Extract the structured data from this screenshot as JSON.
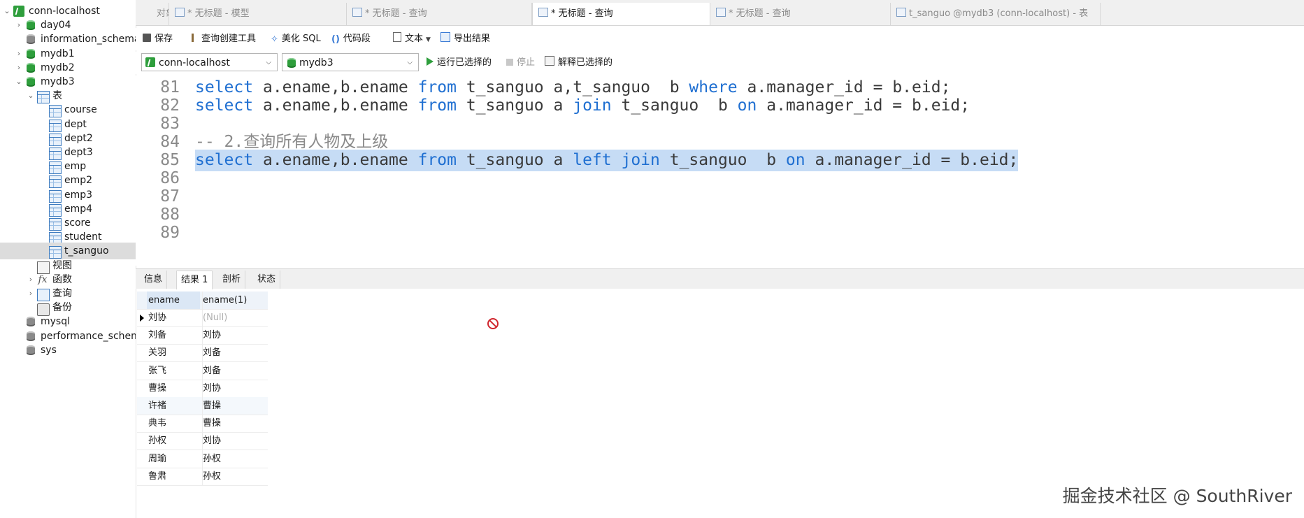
{
  "sidebar": {
    "items": [
      {
        "label": "conn-localhost",
        "icon": "connection-icon",
        "expanded": true
      },
      {
        "label": "day04",
        "icon": "database-icon"
      },
      {
        "label": "information_schema",
        "icon": "database-icon"
      },
      {
        "label": "mydb1",
        "icon": "database-icon"
      },
      {
        "label": "mydb2",
        "icon": "database-icon"
      },
      {
        "label": "mydb3",
        "icon": "database-icon",
        "expanded": true
      },
      {
        "label": "表",
        "icon": "tables-folder-icon",
        "expanded": true
      },
      {
        "label": "course",
        "icon": "table-icon"
      },
      {
        "label": "dept",
        "icon": "table-icon"
      },
      {
        "label": "dept2",
        "icon": "table-icon"
      },
      {
        "label": "dept3",
        "icon": "table-icon"
      },
      {
        "label": "emp",
        "icon": "table-icon"
      },
      {
        "label": "emp2",
        "icon": "table-icon"
      },
      {
        "label": "emp3",
        "icon": "table-icon"
      },
      {
        "label": "emp4",
        "icon": "table-icon"
      },
      {
        "label": "score",
        "icon": "table-icon"
      },
      {
        "label": "student",
        "icon": "table-icon"
      },
      {
        "label": "t_sanguo",
        "icon": "table-icon",
        "selected": true
      },
      {
        "label": "视图",
        "icon": "view-icon"
      },
      {
        "label": "函数",
        "icon": "function-icon"
      },
      {
        "label": "查询",
        "icon": "query-icon"
      },
      {
        "label": "备份",
        "icon": "backup-icon"
      },
      {
        "label": "mysql",
        "icon": "database-icon"
      },
      {
        "label": "performance_schema",
        "icon": "database-icon"
      },
      {
        "label": "sys",
        "icon": "database-icon"
      }
    ]
  },
  "tabs": [
    {
      "label": "对象",
      "active": false
    },
    {
      "label": "* 无标题 - 模型",
      "active": false
    },
    {
      "label": "* 无标题 - 查询",
      "active": false
    },
    {
      "label": "* 无标题 - 查询",
      "active": true
    },
    {
      "label": "* 无标题 - 查询",
      "active": false
    },
    {
      "label": "t_sanguo @mydb3 (conn-localhost) - 表",
      "active": false
    }
  ],
  "toolbar": {
    "save": "保存",
    "query_builder": "查询创建工具",
    "beautify": "美化 SQL",
    "snippet": "代码段",
    "text": "文本",
    "export": "导出结果",
    "connection": "conn-localhost",
    "database": "mydb3",
    "run_selected": "运行已选择的",
    "stop": "停止",
    "explain_selected": "解释已选择的"
  },
  "editor": {
    "lines": [
      {
        "num": "81",
        "text": "select a.ename,b.ename from t_sanguo a,t_sanguo  b where a.manager_id = b.eid;"
      },
      {
        "num": "82",
        "text": "select a.ename,b.ename from t_sanguo a join t_sanguo  b on a.manager_id = b.eid;"
      },
      {
        "num": "83",
        "text": ""
      },
      {
        "num": "84",
        "text": "-- 2.查询所有人物及上级"
      },
      {
        "num": "85",
        "text": "select a.ename,b.ename from t_sanguo a left join t_sanguo  b on a.manager_id = b.eid;"
      },
      {
        "num": "86",
        "text": ""
      },
      {
        "num": "87",
        "text": ""
      },
      {
        "num": "88",
        "text": ""
      },
      {
        "num": "89",
        "text": ""
      }
    ]
  },
  "result_tabs": [
    {
      "label": "信息",
      "active": false
    },
    {
      "label": "结果 1",
      "active": true
    },
    {
      "label": "剖析",
      "active": false
    },
    {
      "label": "状态",
      "active": false
    }
  ],
  "result": {
    "columns": [
      "ename",
      "ename(1)"
    ],
    "rows": [
      [
        "刘协",
        "(Null)"
      ],
      [
        "刘备",
        "刘协"
      ],
      [
        "关羽",
        "刘备"
      ],
      [
        "张飞",
        "刘备"
      ],
      [
        "曹操",
        "刘协"
      ],
      [
        "许褚",
        "曹操"
      ],
      [
        "典韦",
        "曹操"
      ],
      [
        "孙权",
        "刘协"
      ],
      [
        "周瑜",
        "孙权"
      ],
      [
        "鲁肃",
        "孙权"
      ]
    ]
  },
  "watermark": "掘金技术社区 @ SouthRiver",
  "colors": {
    "keyword": "#1f6fd1",
    "selection": "#c6dcf5",
    "green_db": "#2e9e3c"
  }
}
